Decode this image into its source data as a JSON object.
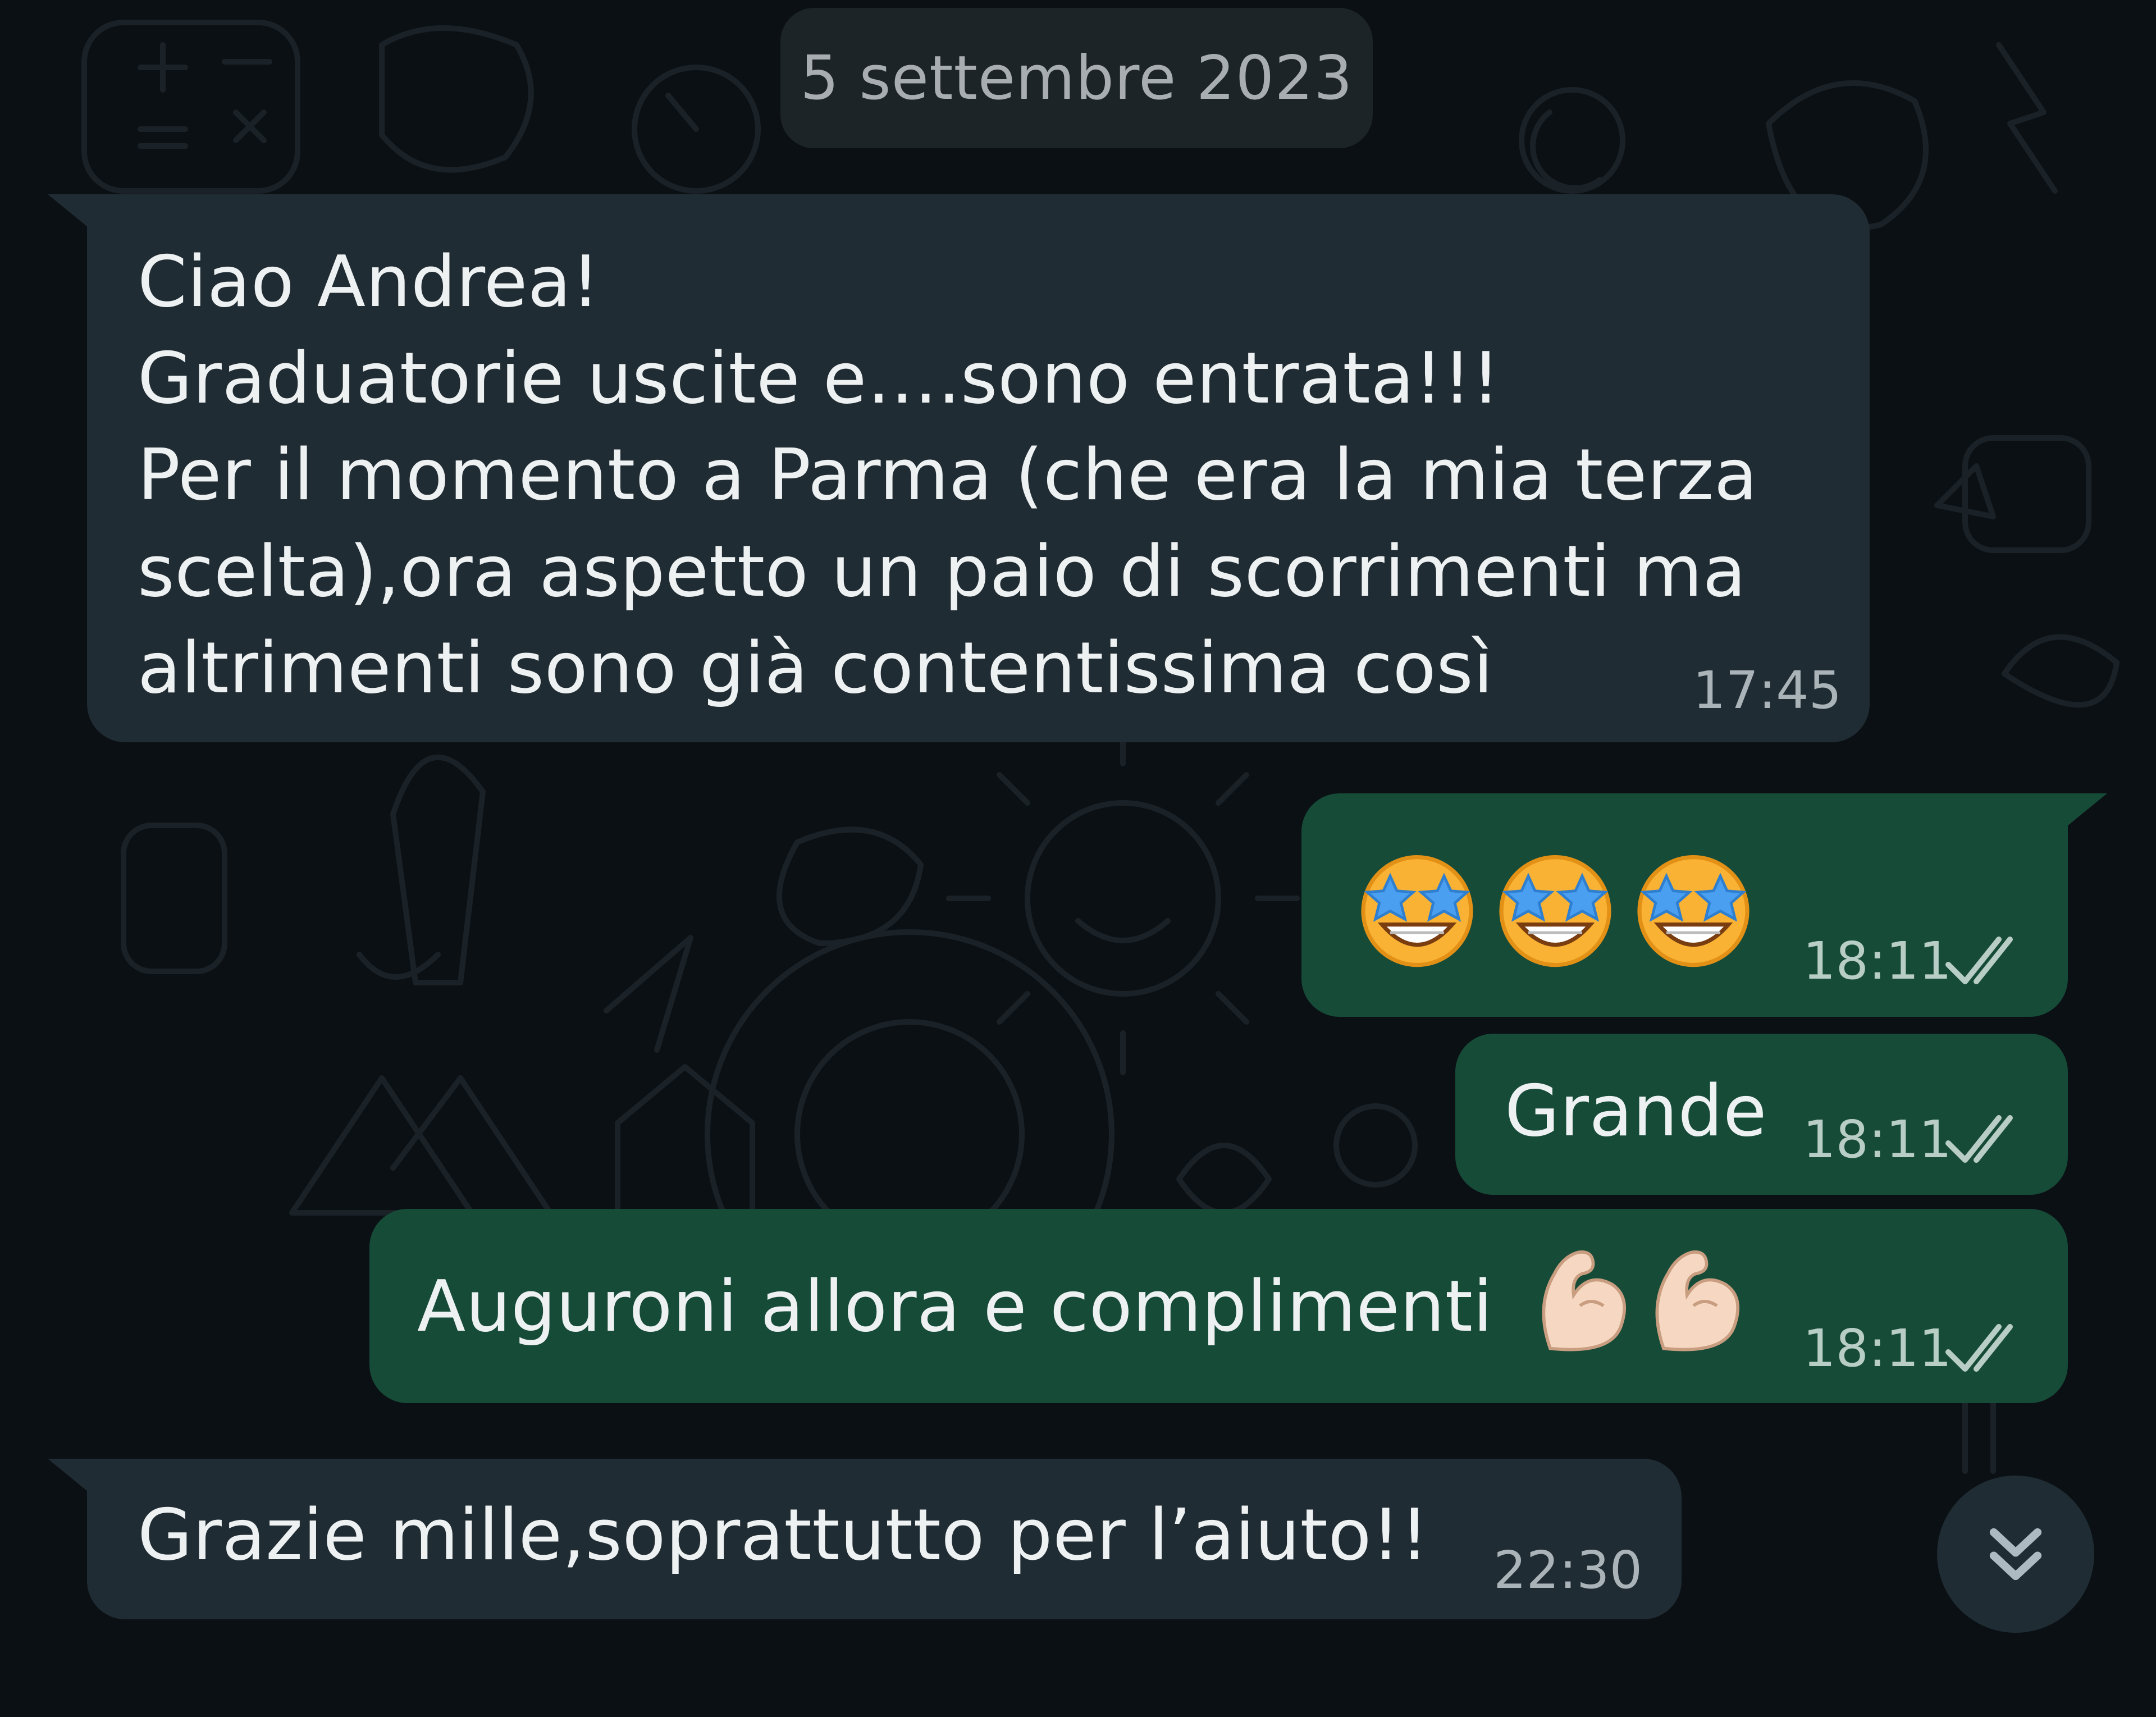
{
  "date_separator": "5 settembre 2023",
  "messages": [
    {
      "direction": "incoming",
      "text": "Ciao Andrea!\nGraduatorie uscite e….sono entrata!!!\nPer il momento a Parma (che era la mia terza\nscelta),ora aspetto un paio di scorrimenti ma\naltrimenti sono già contentissima così",
      "time": "17:45"
    },
    {
      "direction": "outgoing",
      "emoji": [
        "star-struck",
        "star-struck",
        "star-struck"
      ],
      "time": "18:11",
      "status": "read"
    },
    {
      "direction": "outgoing",
      "text": "Grande",
      "time": "18:11",
      "status": "read"
    },
    {
      "direction": "outgoing",
      "text": "Auguroni allora e complimenti",
      "emoji": [
        "flexed-biceps",
        "flexed-biceps"
      ],
      "time": "18:11",
      "status": "read"
    },
    {
      "direction": "incoming",
      "text": "Grazie mille,soprattutto per l’aiuto!!",
      "time": "22:30"
    }
  ],
  "colors": {
    "background": "#0b1014",
    "incoming_bubble": "#202c33",
    "outgoing_bubble": "#164b38",
    "read_ticks": "#b8cdc5"
  },
  "icons": {
    "scroll_button": "double-chevron-down-icon",
    "read_receipt": "double-check-icon"
  }
}
